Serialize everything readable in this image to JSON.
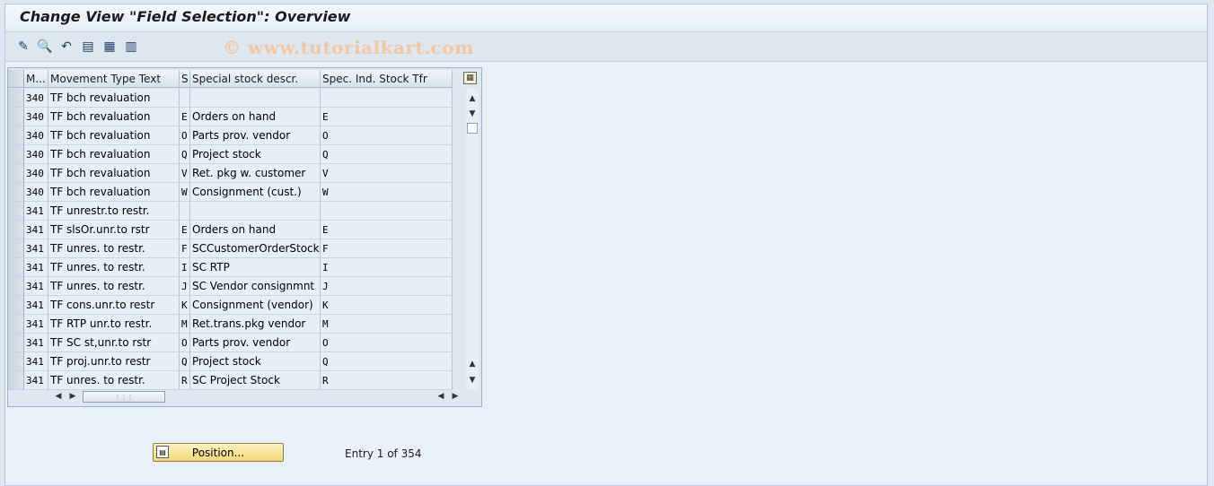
{
  "window": {
    "title": "Change View \"Field Selection\": Overview",
    "watermark": "© www.tutorialkart.com"
  },
  "toolbar": {
    "icons": [
      "pencil-glasses-icon",
      "find-icon",
      "undo-icon",
      "select-all-icon",
      "select-block-icon",
      "deselect-all-icon"
    ],
    "glyphs": [
      "✎",
      "🔍",
      "↶",
      "▤",
      "▦",
      "▥"
    ]
  },
  "table": {
    "columns": [
      "M...",
      "Movement Type Text",
      "S",
      "Special stock descr.",
      "Spec. Ind. Stock Tfr"
    ],
    "rows": [
      [
        "340",
        "TF bch revaluation",
        "",
        "",
        ""
      ],
      [
        "340",
        "TF bch revaluation",
        "E",
        "Orders on hand",
        "E"
      ],
      [
        "340",
        "TF bch revaluation",
        "O",
        "Parts prov. vendor",
        "O"
      ],
      [
        "340",
        "TF bch revaluation",
        "Q",
        "Project stock",
        "Q"
      ],
      [
        "340",
        "TF bch revaluation",
        "V",
        "Ret. pkg w. customer",
        "V"
      ],
      [
        "340",
        "TF bch revaluation",
        "W",
        "Consignment (cust.)",
        "W"
      ],
      [
        "341",
        "TF unrestr.to restr.",
        "",
        "",
        ""
      ],
      [
        "341",
        "TF slsOr.unr.to rstr",
        "E",
        "Orders on hand",
        "E"
      ],
      [
        "341",
        "TF unres. to restr.",
        "F",
        "SCCustomerOrderStock",
        "F"
      ],
      [
        "341",
        "TF unres. to restr.",
        "I",
        "SC RTP",
        "I"
      ],
      [
        "341",
        "TF unres. to restr.",
        "J",
        "SC Vendor consignmnt",
        "J"
      ],
      [
        "341",
        "TF cons.unr.to restr",
        "K",
        "Consignment (vendor)",
        "K"
      ],
      [
        "341",
        "TF RTP unr.to restr.",
        "M",
        "Ret.trans.pkg vendor",
        "M"
      ],
      [
        "341",
        "TF SC st,unr.to rstr",
        "O",
        "Parts prov. vendor",
        "O"
      ],
      [
        "341",
        "TF proj.unr.to restr",
        "Q",
        "Project stock",
        "Q"
      ],
      [
        "341",
        "TF unres. to restr.",
        "R",
        "SC Project Stock",
        "R"
      ]
    ]
  },
  "footer": {
    "position_label": "Position...",
    "entry_text": "Entry 1 of 354"
  }
}
